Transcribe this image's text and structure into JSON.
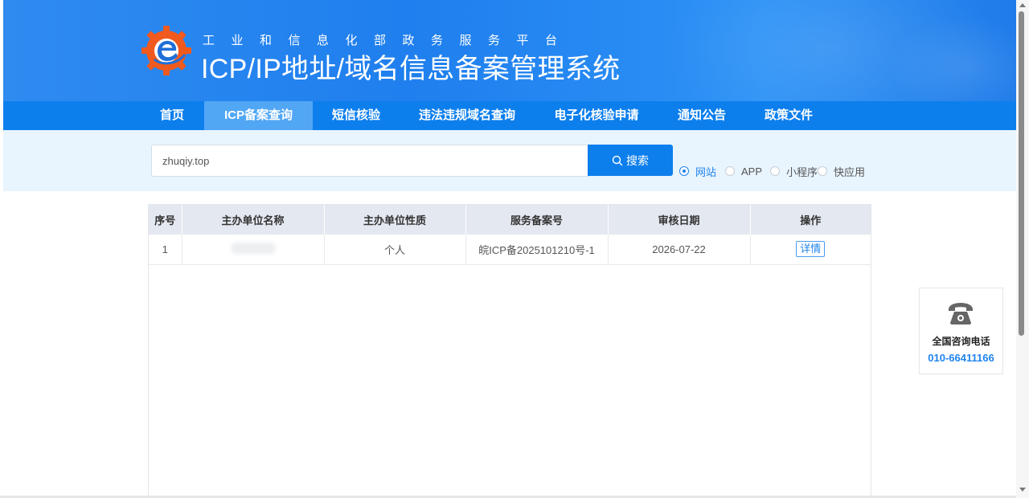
{
  "header": {
    "subtitle": "工业和信息化部政务服务平台",
    "title": "ICP/IP地址/域名信息备案管理系统",
    "logo_icon": "gear-e-logo-icon",
    "brand_colors": {
      "orange": "#f05a1e",
      "blue": "#1f7fee"
    }
  },
  "nav": {
    "items": [
      {
        "label": "首页"
      },
      {
        "label": "ICP备案查询",
        "active": true
      },
      {
        "label": "短信核验"
      },
      {
        "label": "违法违规域名查询"
      },
      {
        "label": "电子化核验申请"
      },
      {
        "label": "通知公告"
      },
      {
        "label": "政策文件"
      }
    ]
  },
  "search": {
    "value": "zhuqiy.top",
    "placeholder": "",
    "button_label": "搜索",
    "button_icon": "search-icon",
    "types": [
      {
        "label": "网站",
        "checked": true
      },
      {
        "label": "APP",
        "checked": false
      },
      {
        "label": "小程序",
        "checked": false
      },
      {
        "label": "快应用",
        "checked": false
      }
    ]
  },
  "table": {
    "columns": [
      "序号",
      "主办单位名称",
      "主办单位性质",
      "服务备案号",
      "审核日期",
      "操作"
    ],
    "rows": [
      {
        "index": "1",
        "name": "",
        "nature": "个人",
        "license": "皖ICP备2025101210号-1",
        "date": "2026-07-22",
        "action": "详情"
      }
    ]
  },
  "consult": {
    "icon": "telephone-icon",
    "label": "全国咨询电话",
    "number": "010-66411166"
  },
  "colors": {
    "primary": "#0d7fed",
    "nav_active": "#52a7f5",
    "search_band": "#e8f4fe",
    "link": "#1f84ee"
  }
}
